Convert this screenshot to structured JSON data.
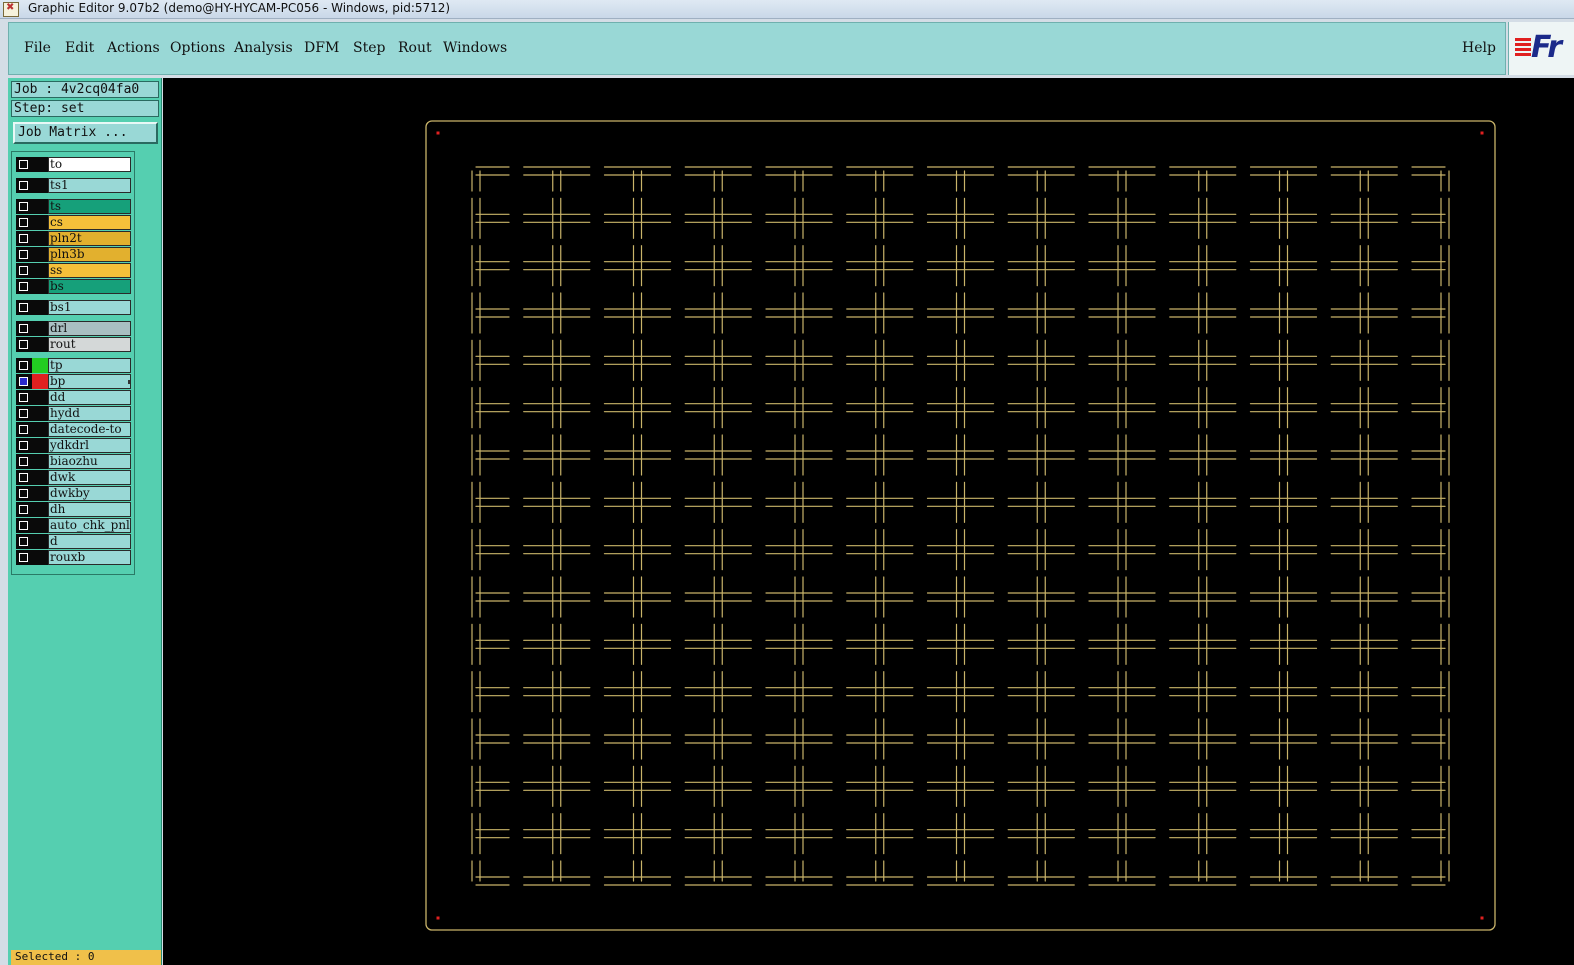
{
  "window": {
    "title": "Graphic Editor 9.07b2 (demo@HY-HYCAM-PC056 - Windows, pid:5712)"
  },
  "menubar": {
    "items": [
      {
        "label": "File"
      },
      {
        "label": "Edit"
      },
      {
        "label": "Actions"
      },
      {
        "label": "Options"
      },
      {
        "label": "Analysis"
      },
      {
        "label": "DFM"
      },
      {
        "label": "Step"
      },
      {
        "label": "Rout"
      },
      {
        "label": "Windows"
      }
    ],
    "help": "Help",
    "logo_text": "Fr"
  },
  "job": {
    "job_line": "Job : 4v2cq04fa0",
    "step_line": "Step: set",
    "matrix_button": "Job Matrix ..."
  },
  "layers": [
    {
      "name": "to",
      "bg": "#ffffff"
    },
    {
      "name": "ts1",
      "bg": "#99d8d6"
    },
    {
      "name": "ts",
      "bg": "#16a07a"
    },
    {
      "name": "cs",
      "bg": "#f5c03a"
    },
    {
      "name": "pln2t",
      "bg": "#e2b02e"
    },
    {
      "name": "pln3b",
      "bg": "#e2b02e"
    },
    {
      "name": "ss",
      "bg": "#f5c03a"
    },
    {
      "name": "bs",
      "bg": "#16a07a"
    },
    {
      "name": "bs1",
      "bg": "#99d8d6"
    },
    {
      "name": "drl",
      "bg": "#a9bfc2"
    },
    {
      "name": "rout",
      "bg": "#d4d8d8"
    },
    {
      "name": "tp",
      "bg": "#99d8d6",
      "color": "#22cc22"
    },
    {
      "name": "bp",
      "bg": "#99d8d6",
      "color": "#e02020",
      "checked": true,
      "marker": true
    },
    {
      "name": "dd",
      "bg": "#99d8d6"
    },
    {
      "name": "hydd",
      "bg": "#99d8d6"
    },
    {
      "name": "datecode-to",
      "bg": "#99d8d6"
    },
    {
      "name": "ydkdrl",
      "bg": "#99d8d6"
    },
    {
      "name": "biaozhu",
      "bg": "#99d8d6"
    },
    {
      "name": "dwk",
      "bg": "#99d8d6"
    },
    {
      "name": "dwkby",
      "bg": "#99d8d6"
    },
    {
      "name": "dh",
      "bg": "#99d8d6"
    },
    {
      "name": "auto_chk_pnl",
      "bg": "#99d8d6"
    },
    {
      "name": "d",
      "bg": "#99d8d6"
    },
    {
      "name": "rouxb",
      "bg": "#99d8d6"
    }
  ],
  "status": {
    "selected": "Selected : 0"
  },
  "drawing": {
    "columns": 12,
    "rows": 16,
    "stroke_color": "#c9b46a",
    "corner_mark_color": "#e02020"
  }
}
